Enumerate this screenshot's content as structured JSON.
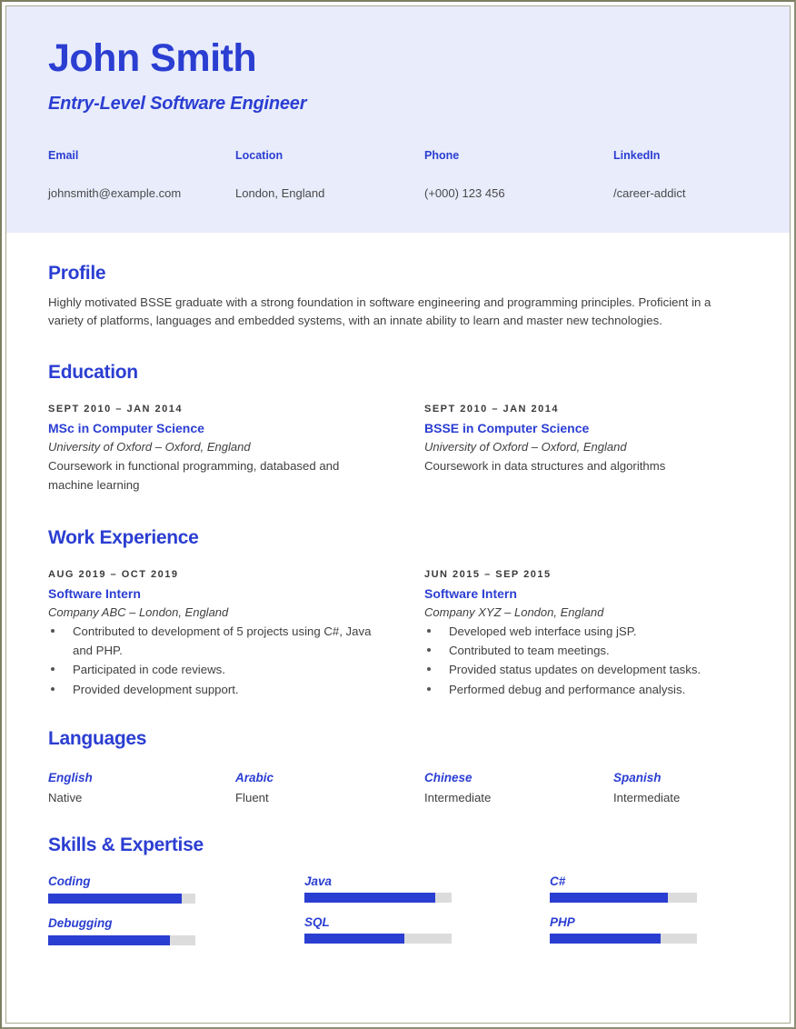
{
  "theme": {
    "accent": "#2b3ed2",
    "header_band": "#e8ecfb",
    "body_text": "#404040",
    "bar_track": "#dcdcdc",
    "page_border": "#8d8d74"
  },
  "header": {
    "name": "John Smith",
    "job_title": "Entry-Level Software Engineer",
    "contacts": [
      {
        "label": "Email",
        "value": "johnsmith@example.com"
      },
      {
        "label": "Location",
        "value": "London, England"
      },
      {
        "label": "Phone",
        "value": "(+000) 123 456"
      },
      {
        "label": "LinkedIn",
        "value": "/career-addict"
      }
    ]
  },
  "profile": {
    "title": "Profile",
    "text": "Highly motivated BSSE graduate with a strong foundation in software engineering and programming principles. Proficient in a variety of platforms, languages and embedded systems, with an innate ability to learn and master new technologies."
  },
  "education": {
    "title": "Education",
    "entries": [
      {
        "date": "SEPT 2010 – JAN 2014",
        "degree": "MSc in Computer Science",
        "school": "University of Oxford – Oxford, England",
        "description": "Coursework in functional programming, databased and machine learning"
      },
      {
        "date": "SEPT 2010 – JAN 2014",
        "degree": "BSSE in Computer Science",
        "school": "University of Oxford – Oxford, England",
        "description": "Coursework in data structures and algorithms"
      }
    ]
  },
  "work": {
    "title": "Work Experience",
    "entries": [
      {
        "date": "AUG 2019 – OCT 2019",
        "role": "Software Intern",
        "company": "Company ABC – London, England",
        "bullets": [
          "Contributed to development of 5 projects using C#, Java and PHP.",
          "Participated in code reviews.",
          "Provided development support."
        ]
      },
      {
        "date": "JUN 2015 – SEP 2015",
        "role": "Software Intern",
        "company": "Company XYZ – London, England",
        "bullets": [
          "Developed web interface using jSP.",
          "Contributed to team meetings.",
          "Provided status updates on development tasks.",
          "Performed debug and performance analysis."
        ]
      }
    ]
  },
  "languages": {
    "title": "Languages",
    "items": [
      {
        "name": "English",
        "level": "Native"
      },
      {
        "name": "Arabic",
        "level": "Fluent"
      },
      {
        "name": "Chinese",
        "level": "Intermediate"
      },
      {
        "name": "Spanish",
        "level": "Intermediate"
      }
    ]
  },
  "skills": {
    "title": "Skills & Expertise",
    "columns": [
      [
        {
          "name": "Coding",
          "percent": 91
        },
        {
          "name": "Debugging",
          "percent": 83
        }
      ],
      [
        {
          "name": "Java",
          "percent": 89
        },
        {
          "name": "SQL",
          "percent": 68
        }
      ],
      [
        {
          "name": "C#",
          "percent": 80
        },
        {
          "name": "PHP",
          "percent": 75
        }
      ]
    ]
  }
}
